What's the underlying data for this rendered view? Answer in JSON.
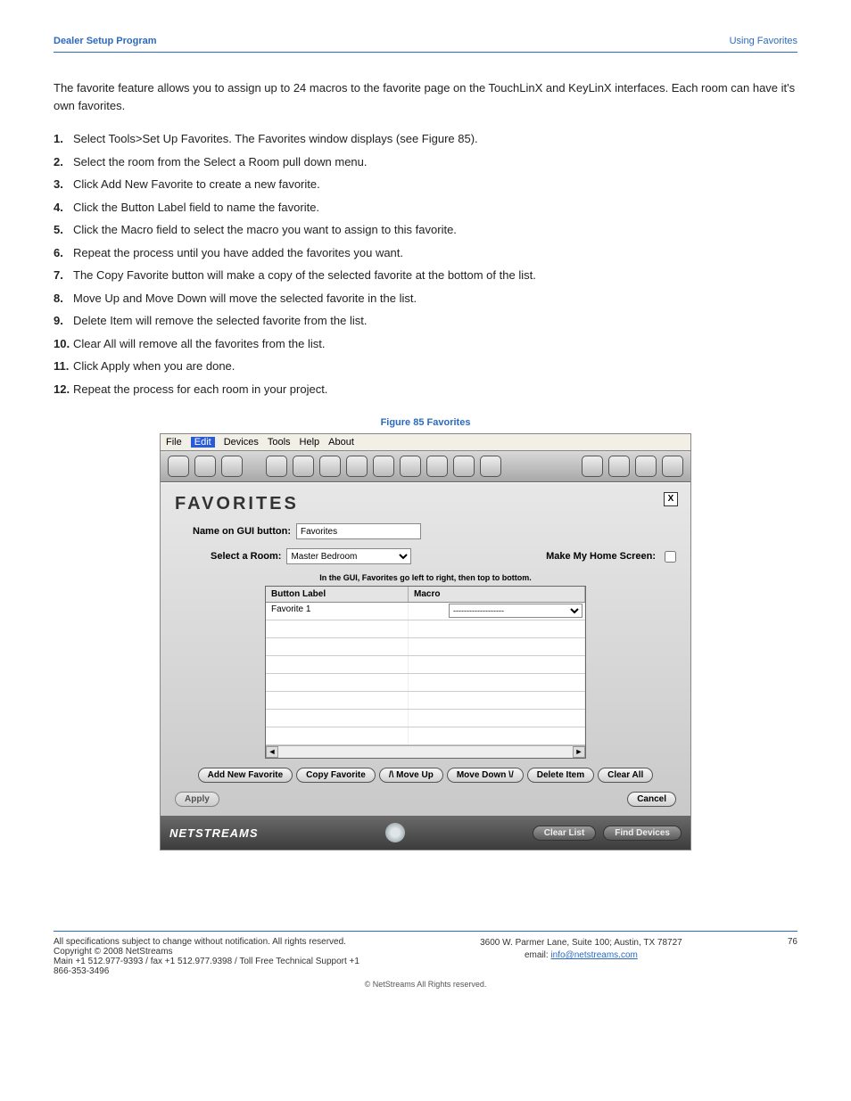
{
  "doc": {
    "header_left": "Dealer Setup Program",
    "header_right": "Using Favorites",
    "intro": "The favorite feature allows you to assign up to 24 macros to the favorite page on the TouchLinX and KeyLinX interfaces. Each room can have it's own favorites.",
    "steps": [
      "Select Tools>Set Up Favorites. The Favorites window displays (see Figure 85).",
      "Select the room from the Select a Room pull down menu.",
      "Click Add New Favorite to create a new favorite.",
      "Click the Button Label field to name the favorite.",
      "Click the Macro field to select the macro you want to assign to this favorite.",
      "Repeat the process until you have added the favorites you want.",
      "The Copy Favorite button will make a copy of the selected favorite at the bottom of the list.",
      "Move Up and Move Down will move the selected favorite in the list.",
      "Delete Item will remove the selected favorite from the list.",
      "Clear All will remove all the favorites from the list.",
      "Click Apply when you are done.",
      "Repeat the process for each room in your project."
    ],
    "fig_caption": "Figure 85  Favorites"
  },
  "app": {
    "menus": [
      "File",
      "Edit",
      "Devices",
      "Tools",
      "Help",
      "About"
    ],
    "menu_active_index": 1,
    "panel_title": "FAVORITES",
    "close_x": "X",
    "name_label": "Name on GUI button:",
    "name_value": "Favorites",
    "room_label": "Select a Room:",
    "room_value": "Master Bedroom",
    "home_label": "Make My Home Screen:",
    "grid_note": "In the GUI, Favorites go left to right, then top to bottom.",
    "col1": "Button Label",
    "col2": "Macro",
    "row1_label": "Favorite 1",
    "row1_macro": "-------------------",
    "buttons": {
      "add": "Add New Favorite",
      "copy": "Copy Favorite",
      "up": "/\\  Move Up",
      "down": "Move Down \\/",
      "del": "Delete Item",
      "clear": "Clear All",
      "apply": "Apply",
      "cancel": "Cancel",
      "clear_list": "Clear List",
      "find": "Find Devices"
    },
    "brand": "NETSTREAMS"
  },
  "footer": {
    "left1": "All specifications subject to change without notification. All rights reserved. Copyright © 2008 NetStreams",
    "left2": "Main +1 512.977-9393 / fax +1 512.977.9398 / Toll Free Technical Support +1 866-353-3496",
    "addr1": "3600 W. Parmer Lane, Suite 100; Austin, TX 78727",
    "email_prefix": "email: ",
    "email": "info@netstreams.com",
    "page": "76",
    "copy": "©  NetStreams All Rights reserved."
  }
}
